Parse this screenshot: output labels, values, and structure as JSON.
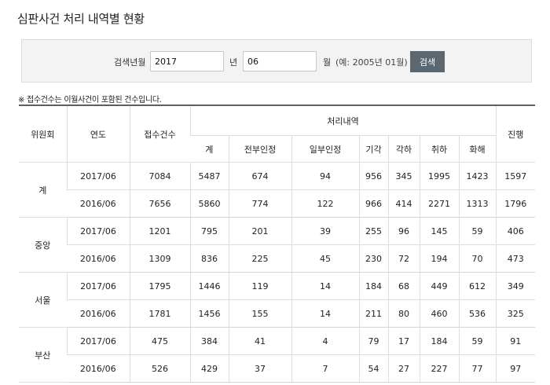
{
  "page_title": "심판사건 처리 내역별 현황",
  "search": {
    "label": "검색년월",
    "year_value": "2017",
    "year_unit": "년",
    "month_value": "06",
    "month_unit": "월",
    "hint": "(예: 2005년 01월)",
    "button_label": "검색"
  },
  "note": "※ 접수건수는 이월사건이 포함된 건수입니다.",
  "table": {
    "headers": {
      "committee": "위원회",
      "period": "연도",
      "received": "접수건수",
      "processing_group": "처리내역",
      "pending": "진행",
      "sub": [
        "계",
        "전부인정",
        "일부인정",
        "기각",
        "각하",
        "취하",
        "화해"
      ]
    },
    "groups": [
      {
        "committee": "계",
        "rows": [
          [
            "2017/06",
            "7084",
            "5487",
            "674",
            "94",
            "956",
            "345",
            "1995",
            "1423",
            "1597"
          ],
          [
            "2016/06",
            "7656",
            "5860",
            "774",
            "122",
            "966",
            "414",
            "2271",
            "1313",
            "1796"
          ]
        ]
      },
      {
        "committee": "중앙",
        "rows": [
          [
            "2017/06",
            "1201",
            "795",
            "201",
            "39",
            "255",
            "96",
            "145",
            "59",
            "406"
          ],
          [
            "2016/06",
            "1309",
            "836",
            "225",
            "45",
            "230",
            "72",
            "194",
            "70",
            "473"
          ]
        ]
      },
      {
        "committee": "서울",
        "rows": [
          [
            "2017/06",
            "1795",
            "1446",
            "119",
            "14",
            "184",
            "68",
            "449",
            "612",
            "349"
          ],
          [
            "2016/06",
            "1781",
            "1456",
            "155",
            "14",
            "211",
            "80",
            "460",
            "536",
            "325"
          ]
        ]
      },
      {
        "committee": "부산",
        "rows": [
          [
            "2017/06",
            "475",
            "384",
            "41",
            "4",
            "79",
            "17",
            "184",
            "59",
            "91"
          ],
          [
            "2016/06",
            "526",
            "429",
            "37",
            "7",
            "54",
            "27",
            "227",
            "77",
            "97"
          ]
        ]
      }
    ]
  }
}
